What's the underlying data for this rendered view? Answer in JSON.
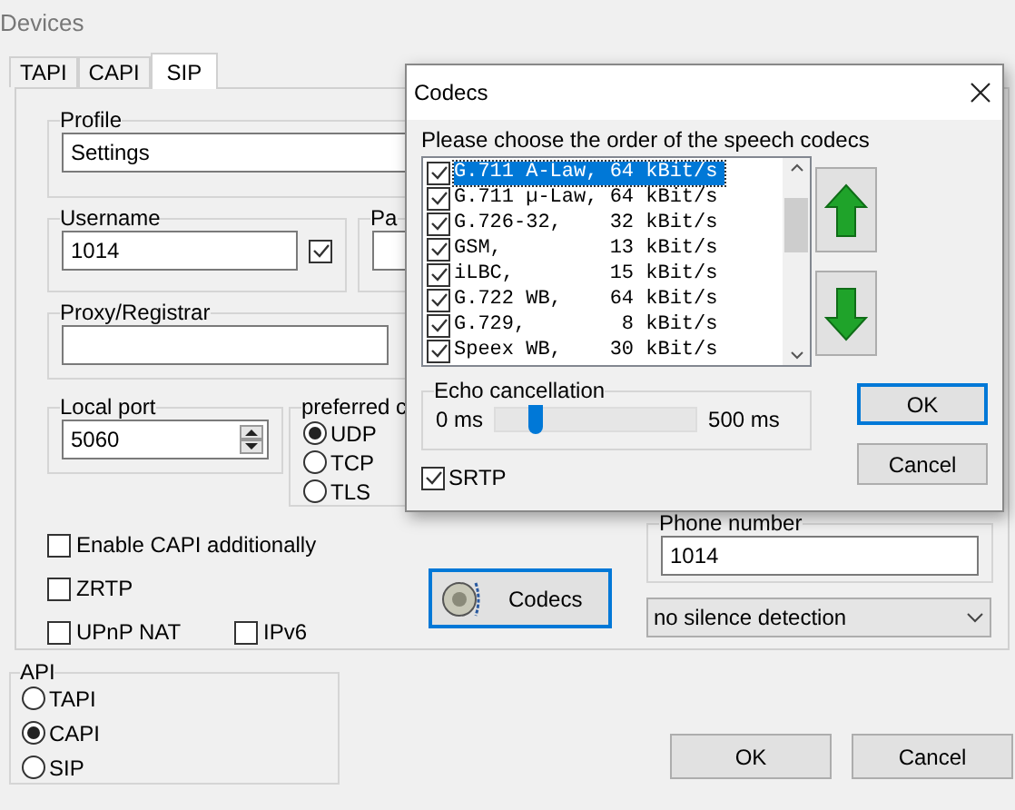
{
  "window": {
    "title": "Devices"
  },
  "tabs": [
    {
      "label": "TAPI",
      "selected": false
    },
    {
      "label": "CAPI",
      "selected": false
    },
    {
      "label": "SIP",
      "selected": true
    }
  ],
  "sip": {
    "profile": {
      "label": "Profile",
      "value": "Settings"
    },
    "username": {
      "label": "Username",
      "value": "1014",
      "checked": true
    },
    "password": {
      "label": "Pa"
    },
    "proxy": {
      "label": "Proxy/Registrar"
    },
    "local_port": {
      "label": "Local port",
      "value": "5060"
    },
    "transport": {
      "label": "preferred c",
      "options": [
        {
          "label": "UDP",
          "selected": true
        },
        {
          "label": "TCP",
          "selected": false
        },
        {
          "label": "TLS",
          "selected": false
        }
      ]
    },
    "options": [
      {
        "label": "Enable CAPI additionally",
        "checked": false
      },
      {
        "label": "ZRTP",
        "checked": false
      },
      {
        "label": "UPnP NAT",
        "checked": false
      },
      {
        "label": "IPv6",
        "checked": false
      }
    ],
    "codecs_button": "Codecs",
    "phone_number": {
      "label": "Phone number",
      "value": "1014"
    },
    "silence": {
      "value": "no silence detection"
    }
  },
  "api": {
    "label": "API",
    "options": [
      {
        "label": "TAPI",
        "selected": false
      },
      {
        "label": "CAPI",
        "selected": true
      },
      {
        "label": "SIP",
        "selected": false
      }
    ]
  },
  "buttons": [
    "OK",
    "Cancel"
  ],
  "codecs_dialog": {
    "title": "Codecs",
    "prompt": "Please choose the order of the speech codecs",
    "codecs": [
      {
        "text": "G.711 A-Law, 64 kBit/s",
        "checked": true,
        "selected": true
      },
      {
        "text": "G.711 µ-Law, 64 kBit/s",
        "checked": true,
        "selected": false
      },
      {
        "text": "G.726-32,    32 kBit/s",
        "checked": true,
        "selected": false
      },
      {
        "text": "GSM,         13 kBit/s",
        "checked": true,
        "selected": false
      },
      {
        "text": "iLBC,        15 kBit/s",
        "checked": true,
        "selected": false
      },
      {
        "text": "G.722 WB,    64 kBit/s",
        "checked": true,
        "selected": false
      },
      {
        "text": "G.729,        8 kBit/s",
        "checked": true,
        "selected": false
      },
      {
        "text": "Speex WB,    30 kBit/s",
        "checked": true,
        "selected": false
      }
    ],
    "echo": {
      "label": "Echo cancellation",
      "min": "0 ms",
      "max": "500 ms",
      "level": 0.2
    },
    "srtp": {
      "label": "SRTP",
      "checked": true
    },
    "buttons": [
      "OK",
      "Cancel"
    ]
  }
}
